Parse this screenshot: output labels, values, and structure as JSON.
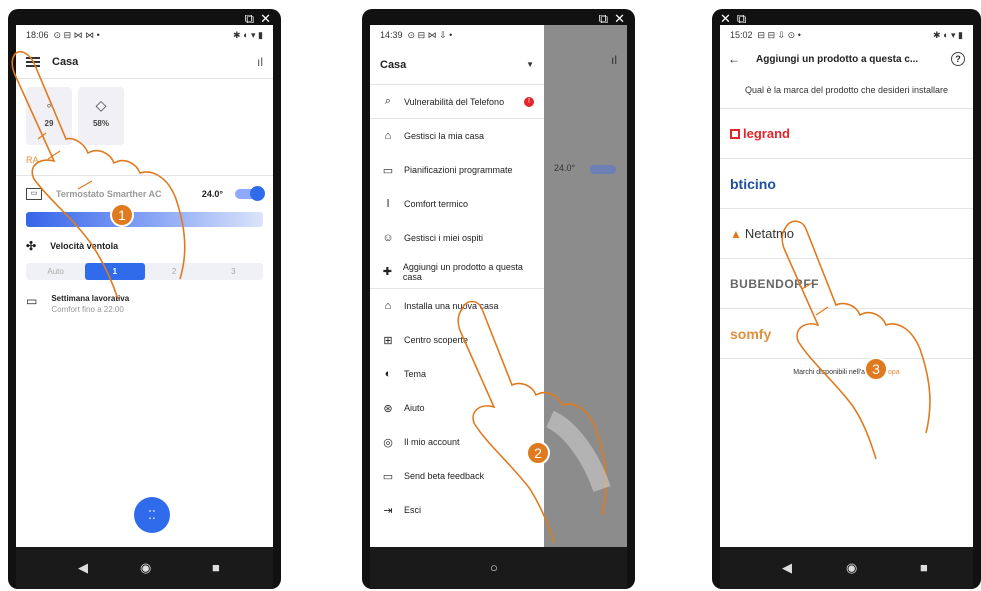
{
  "colors": {
    "accent": "#2f6bea",
    "orange": "#e0903c",
    "step": "#e07a1e",
    "legrand_red": "#e3262b",
    "netatmo": "#e07a1e",
    "somfy": "#e0903c"
  },
  "phone1": {
    "statusbar": {
      "time": "18:06",
      "icons": "⊙ ⊟ ⋈ ⋈ •",
      "right": "✱ ◐ ▾ ▮"
    },
    "appbar": {
      "title": "Casa",
      "bars_icon": "bar-chart-icon"
    },
    "cards": [
      {
        "value": "29"
      },
      {
        "value": "58%"
      }
    ],
    "section_label": "RA",
    "thermostat": {
      "name": "Termostato Smarther AC",
      "temp": "24.0°"
    },
    "fan": {
      "label": "Velocità ventola"
    },
    "segments": [
      "Auto",
      "1",
      "2",
      "3"
    ],
    "schedule": {
      "title": "Settimana lavorativa",
      "subtitle": "Comfort fino a 22:00"
    },
    "step": "1"
  },
  "phone2": {
    "statusbar": {
      "time": "14:39",
      "icons": "⊙ ⊟ ⋈ ⇩ •",
      "right": "✱ ◐ ▾ ▮"
    },
    "drawer_title": "Casa",
    "menu": [
      {
        "label": "Vulnerabilità del Telefono",
        "icon": "phone-search-icon"
      },
      {
        "label": "Gestisci la mia casa",
        "icon": "home-icon"
      },
      {
        "label": "Pianificazioni programmate",
        "icon": "calendar-icon"
      },
      {
        "label": "Comfort termico",
        "icon": "thermometer-icon"
      },
      {
        "label": "Gestisci i miei ospiti",
        "icon": "guests-icon"
      },
      {
        "label": "Aggiungi un prodotto a questa casa",
        "icon": "plus-icon"
      },
      {
        "label": "Installa una nuova casa",
        "icon": "home-plus-icon"
      },
      {
        "label": "Centro scoperte",
        "icon": "grid-icon"
      },
      {
        "label": "Tema",
        "icon": "theme-icon"
      },
      {
        "label": "Aiuto",
        "icon": "help-icon"
      },
      {
        "label": "Il mio account",
        "icon": "account-icon"
      },
      {
        "label": "Send beta feedback",
        "icon": "feedback-icon"
      },
      {
        "label": "Esci",
        "icon": "exit-icon"
      }
    ],
    "dim_temp": "24.0°",
    "step": "2"
  },
  "phone3": {
    "statusbar": {
      "time": "15:02",
      "icons": "⊟ ⊟ ⇩ ⊙ •",
      "right": "✱ ◐ ▾ ▮"
    },
    "title": "Aggiungi un prodotto a questa c...",
    "question": "Qual è la marca del prodotto che desideri installare",
    "brands": [
      "legrand",
      "bticino",
      "Netatmo",
      "BUBENDORFF",
      "somfy"
    ],
    "footnote_prefix": "Marchi disponibili nell'area",
    "footnote_link": "Europa",
    "step": "3"
  }
}
